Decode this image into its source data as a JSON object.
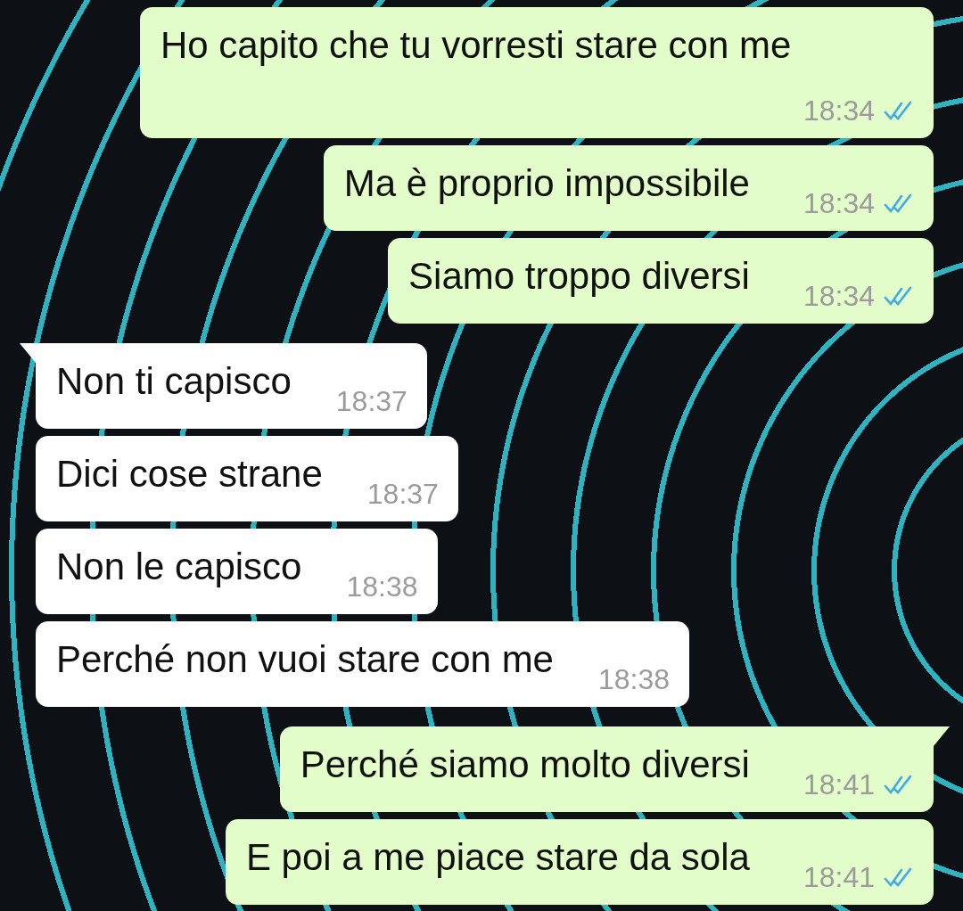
{
  "messages": [
    {
      "kind": "sent",
      "text": "Ho capito che tu vorresti stare con me",
      "time": "18:34",
      "read": true,
      "tail": false
    },
    {
      "kind": "sent",
      "text": "Ma è proprio impossibile",
      "time": "18:34",
      "read": true,
      "tail": false
    },
    {
      "kind": "sent",
      "text": "Siamo troppo diversi",
      "time": "18:34",
      "read": true,
      "tail": false
    },
    {
      "kind": "received",
      "text": "Non ti capisco",
      "time": "18:37",
      "tail": true
    },
    {
      "kind": "received",
      "text": "Dici cose strane",
      "time": "18:37",
      "tail": false
    },
    {
      "kind": "received",
      "text": "Non le capisco",
      "time": "18:38",
      "tail": false
    },
    {
      "kind": "received",
      "text": "Perché non vuoi stare con me",
      "time": "18:38",
      "tail": false
    },
    {
      "kind": "sent",
      "text": "Perché siamo molto diversi",
      "time": "18:41",
      "read": true,
      "tail": true
    },
    {
      "kind": "sent",
      "text": "E poi a me piace stare da sola",
      "time": "18:41",
      "read": true,
      "tail": false
    }
  ]
}
